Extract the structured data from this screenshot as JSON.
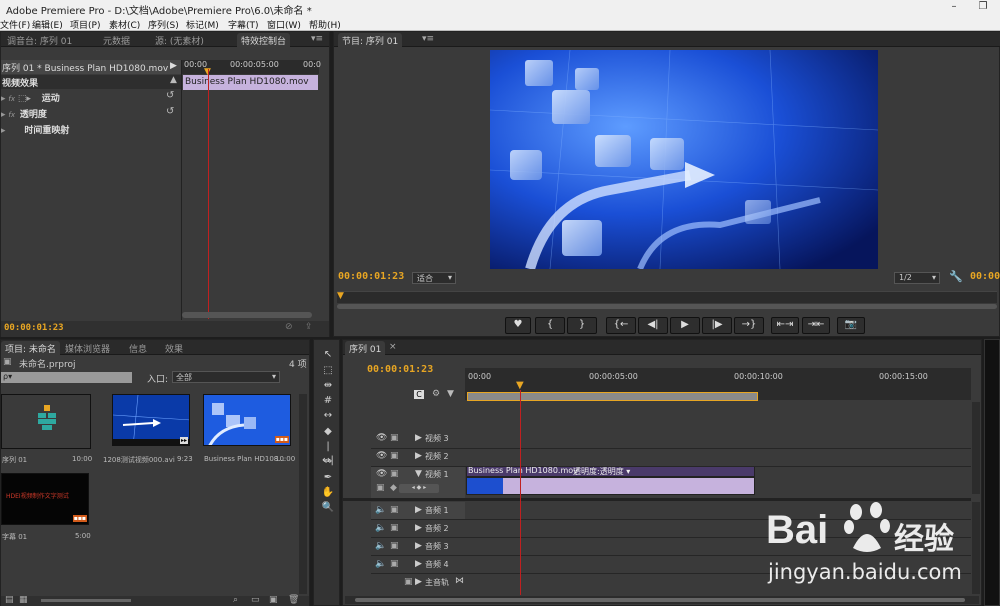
{
  "window": {
    "title": "Adobe Premiere Pro - D:\\文档\\Adobe\\Premiere Pro\\6.0\\未命名 *",
    "minimize": "–",
    "restore": "❐"
  },
  "menu": [
    "文件(F)",
    "编辑(E)",
    "项目(P)",
    "素材(C)",
    "序列(S)",
    "标记(M)",
    "字幕(T)",
    "窗口(W)",
    "帮助(H)"
  ],
  "topLeftTabs": [
    "调音台: 序列 01",
    "元数据",
    "源: (无素材)",
    "特效控制台"
  ],
  "effectControls": {
    "header": "序列 01 * Business Plan HD1080.mov",
    "times": [
      "00:00",
      "00:00:05:00",
      "00:0"
    ],
    "clip": "Business Plan HD1080.mov",
    "section": "视频效果",
    "effects": [
      "运动",
      "透明度",
      "时间重映射"
    ],
    "timecode": "00:00:01:23"
  },
  "program": {
    "tab": "节目: 序列 01",
    "timecode": "00:00:01:23",
    "fit": "适合",
    "ratio": "1/2",
    "timecodeRight": "00:00:"
  },
  "transport": [
    "♥",
    "{",
    "}",
    "{←",
    "◀|",
    "▶",
    "|▶",
    "→}",
    "⇤⇥",
    "⇥⇤",
    "📷"
  ],
  "project": {
    "tabs": [
      "项目: 未命名",
      "媒体浏览器",
      "信息",
      "效果"
    ],
    "count": "4 项",
    "file": "未命名.prproj",
    "search": "ρ▾",
    "inLabel": "入口:",
    "inValue": "全部",
    "items": [
      {
        "name": "序列 01",
        "dur": "10:00"
      },
      {
        "name": "1208测试视频000.avi",
        "dur": "9:23"
      },
      {
        "name": "Business Plan HD108...",
        "dur": "10:00"
      },
      {
        "name": "字幕 01",
        "dur": "5:00"
      }
    ],
    "titleText": "HDEI视频制作文字测试"
  },
  "timeline": {
    "tab": "序列 01",
    "timecode": "00:00:01:23",
    "ruler": [
      "00:00",
      "00:00:05:00",
      "00:00:10:00",
      "00:00:15:00"
    ],
    "videoTracks": [
      "视频 3",
      "视频 2",
      "视频 1"
    ],
    "audioTracks": [
      "音频 1",
      "音频 2",
      "音频 3",
      "音频 4",
      "主音轨"
    ],
    "clip": "Business Plan HD1080.mov",
    "clipFx": "透明度:透明度 ▾"
  },
  "watermark": {
    "brand": "Bai",
    "suffix": "经验",
    "url": "jingyan.baidu.com"
  },
  "colors": {
    "accent": "#e8a623",
    "clip": "#c6b2dd",
    "playhead": "#c02020"
  }
}
